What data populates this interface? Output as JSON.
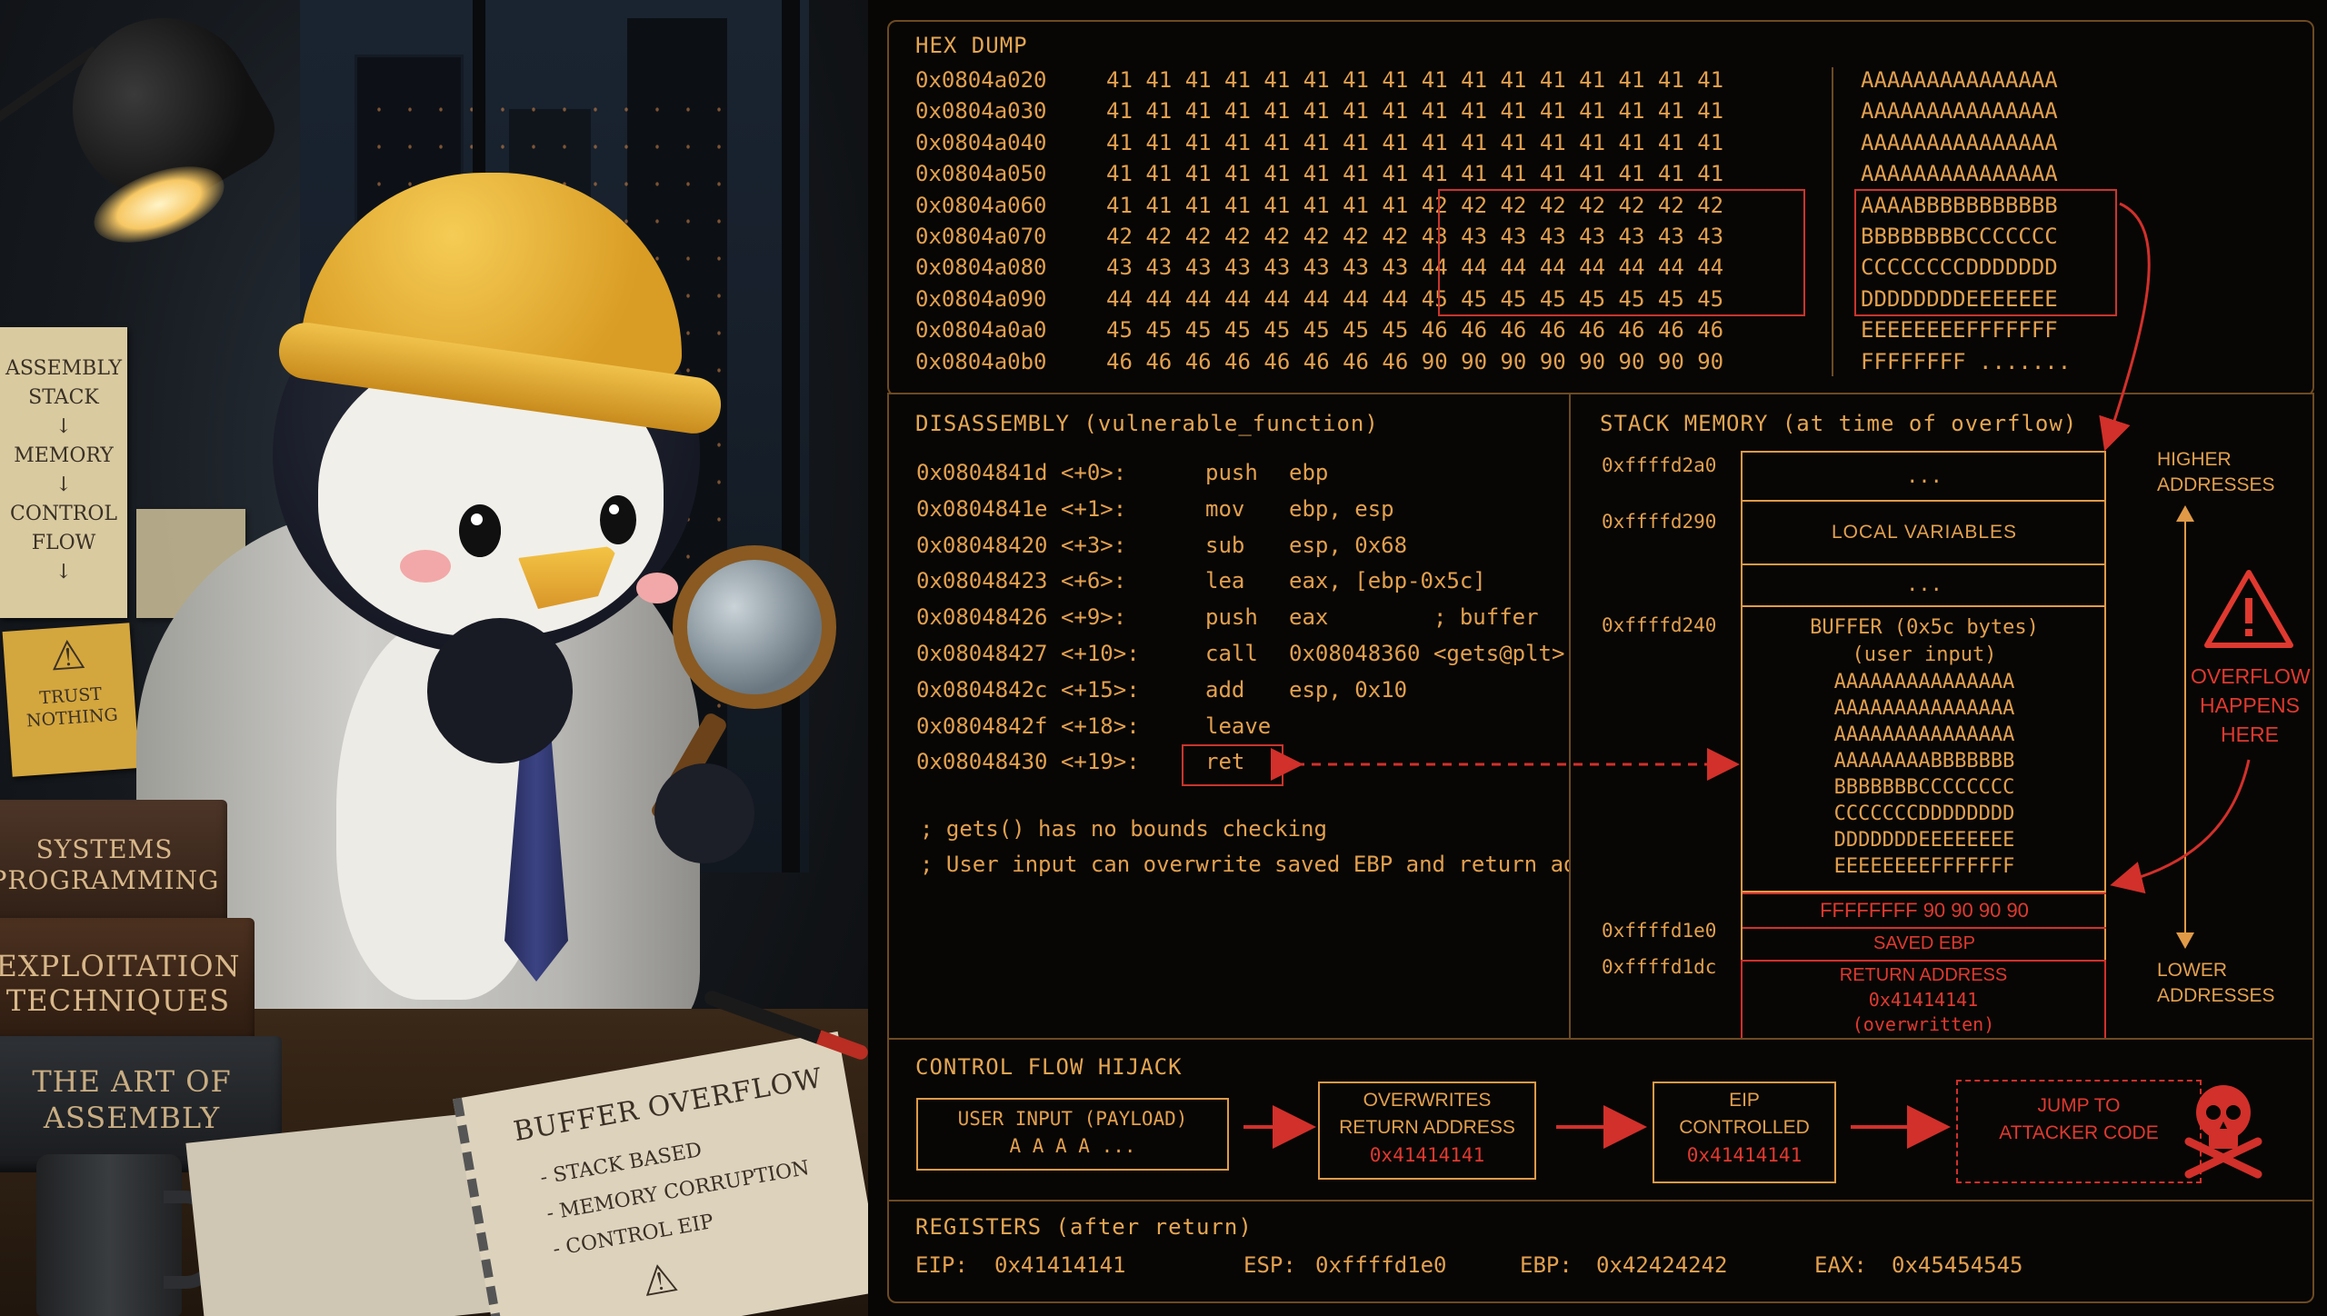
{
  "illustration": {
    "note_left": "ASSEMBLY\nSTACK\n↓\nMEMORY\n↓\nCONTROL\nFLOW\n↓",
    "note_warning": "TRUST\nNOTHING",
    "books": [
      "SYSTEMS\nPROGRAMMING",
      "EXPLOITATION\nTECHNIQUES",
      "THE ART OF\nASSEMBLY"
    ],
    "notebook_title": "BUFFER OVERFLOW",
    "notebook_lines": [
      "- STACK BASED",
      "- MEMORY CORRUPTION",
      "- CONTROL EIP"
    ]
  },
  "hex": {
    "title": "HEX DUMP",
    "rows": [
      {
        "addr": "0x0804a020",
        "bytes": "41 41 41 41 41 41 41 41 41 41 41 41 41 41 41 41",
        "ascii": "AAAAAAAAAAAAAAA"
      },
      {
        "addr": "0x0804a030",
        "bytes": "41 41 41 41 41 41 41 41 41 41 41 41 41 41 41 41",
        "ascii": "AAAAAAAAAAAAAAA"
      },
      {
        "addr": "0x0804a040",
        "bytes": "41 41 41 41 41 41 41 41 41 41 41 41 41 41 41 41",
        "ascii": "AAAAAAAAAAAAAAA"
      },
      {
        "addr": "0x0804a050",
        "bytes": "41 41 41 41 41 41 41 41 41 41 41 41 41 41 41 41",
        "ascii": "AAAAAAAAAAAAAAA"
      },
      {
        "addr": "0x0804a060",
        "bytes": "41 41 41 41 41 41 41 41 42 42 42 42 42 42 42 42",
        "ascii": "AAAABBBBBBBBBBB"
      },
      {
        "addr": "0x0804a070",
        "bytes": "42 42 42 42 42 42 42 42 43 43 43 43 43 43 43 43",
        "ascii": "BBBBBBBBCCCCCCC"
      },
      {
        "addr": "0x0804a080",
        "bytes": "43 43 43 43 43 43 43 43 44 44 44 44 44 44 44 44",
        "ascii": "CCCCCCCCDDDDDDD"
      },
      {
        "addr": "0x0804a090",
        "bytes": "44 44 44 44 44 44 44 44 45 45 45 45 45 45 45 45",
        "ascii": "DDDDDDDDEEEEEEE"
      },
      {
        "addr": "0x0804a0a0",
        "bytes": "45 45 45 45 45 45 45 45 46 46 46 46 46 46 46 46",
        "ascii": "EEEEEEEEFFFFFFF"
      },
      {
        "addr": "0x0804a0b0",
        "bytes": "46 46 46 46 46 46 46 46 90 90 90 90 90 90 90 90",
        "ascii": "FFFFFFFF ......."
      }
    ]
  },
  "disasm": {
    "title": "DISASSEMBLY (vulnerable_function)",
    "lines": [
      {
        "addr": "0x0804841d <+0>:",
        "op": "push",
        "args": "ebp"
      },
      {
        "addr": "0x0804841e <+1>:",
        "op": "mov",
        "args": "ebp, esp"
      },
      {
        "addr": "0x08048420 <+3>:",
        "op": "sub",
        "args": "esp, 0x68"
      },
      {
        "addr": "0x08048423 <+6>:",
        "op": "lea",
        "args": "eax, [ebp-0x5c]"
      },
      {
        "addr": "0x08048426 <+9>:",
        "op": "push",
        "args": "eax        ; buffer"
      },
      {
        "addr": "0x08048427 <+10>:",
        "op": "call",
        "args": "0x08048360 <gets@plt>"
      },
      {
        "addr": "0x0804842c <+15>:",
        "op": "add",
        "args": "esp, 0x10"
      },
      {
        "addr": "0x0804842f <+18>:",
        "op": "leave",
        "args": ""
      },
      {
        "addr": "0x08048430 <+19>:",
        "op": "ret",
        "args": ""
      }
    ],
    "comments": [
      "; gets() has no bounds checking",
      "; User input can overwrite saved EBP and return address"
    ]
  },
  "stack": {
    "title": "STACK MEMORY (at time of overflow)",
    "addr_labels": [
      "0xffffd2a0",
      "0xffffd290",
      "0xffffd240",
      "0xffffd1e0",
      "0xffffd1dc"
    ],
    "dots": "...",
    "local_vars": "LOCAL VARIABLES",
    "buffer_label": "BUFFER (0x5c bytes)",
    "buffer_sub": "(user input)",
    "buffer_rows": [
      "AAAAAAAAAAAAAAA",
      "AAAAAAAAAAAAAAA",
      "AAAAAAAAAAAAAAA",
      "AAAAAAAABBBBBBB",
      "BBBBBBBCCCCCCCC",
      "CCCCCCCDDDDDDDD",
      "DDDDDDDEEEEEEEE",
      "EEEEEEEEFFFFFFF"
    ],
    "overflow_row": "FFFFFFFF 90 90 90 90",
    "saved_ebp": "SAVED EBP",
    "ret_label": "RETURN ADDRESS",
    "ret_value": "0x41414141",
    "ret_note": "(overwritten)",
    "higher": "HIGHER\nADDRESSES",
    "lower": "LOWER\nADDRESSES",
    "overflow_note": "OVERFLOW\nHAPPENS\nHERE"
  },
  "flow": {
    "title": "CONTROL FLOW HIJACK",
    "box1_line1": "USER INPUT (PAYLOAD)",
    "box1_line2": "A A A A ...",
    "box2_line1": "OVERWRITES",
    "box2_line2": "RETURN ADDRESS",
    "box2_line3": "0x41414141",
    "box3_line1": "EIP",
    "box3_line2": "CONTROLLED",
    "box3_line3": "0x41414141",
    "box4_line1": "JUMP TO",
    "box4_line2": "ATTACKER CODE"
  },
  "registers": {
    "title": "REGISTERS (after return)",
    "eip_label": "EIP:",
    "eip_value": "0x41414141",
    "esp_label": "ESP:",
    "esp_value": "0xffffd1e0",
    "ebp_label": "EBP:",
    "ebp_value": "0x42424242",
    "eax_label": "EAX:",
    "eax_value": "0x45454545"
  },
  "colors": {
    "amber": "#e3a04e",
    "red": "#e0392f",
    "border": "#6d4a22",
    "background": "#070605"
  }
}
